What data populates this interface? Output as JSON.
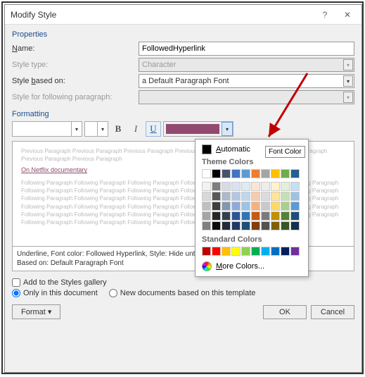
{
  "window": {
    "title": "Modify Style"
  },
  "properties": {
    "header": "Properties",
    "name_label": "Name:",
    "name_value": "FollowedHyperlink",
    "styletype_label": "Style type:",
    "styletype_value": "Character",
    "based_label": "Style based on:",
    "based_value": "a Default Paragraph Font",
    "follow_label": "Style for following paragraph:"
  },
  "formatting": {
    "header": "Formatting",
    "bold": "B",
    "italic": "I",
    "underline": "U"
  },
  "preview": {
    "filler1": "Previous Paragraph Previous Paragraph Previous Paragraph Previous Paragraph Previous Paragraph Previous Paragraph Previous Paragraph Previous Paragraph",
    "link": "On Netflix documentary ",
    "filler2": "Following Paragraph Following Paragraph Following Paragraph Following Paragraph Following Paragraph Following Paragraph Following Paragraph Following Paragraph Following Paragraph Following Paragraph Following Paragraph Following Paragraph Following Paragraph Following Paragraph Following Paragraph Following Paragraph Following Paragraph Following Paragraph Following Paragraph Following Paragraph Following Paragraph Following Paragraph Following Paragraph Following Paragraph Following Paragraph Following Paragraph Following Paragraph Following Paragraph Following Paragraph Following Paragraph Following Paragraph Following Paragraph Following Paragraph Following Paragraph Following Paragraph"
  },
  "description": {
    "line1": "Underline, Font color: Followed Hyperlink, Style: Hide until used, Priority: 100",
    "line2": "Based on: Default Paragraph Font"
  },
  "options": {
    "add_gallery": "Add to the Styles gallery",
    "only_doc": "Only in this document",
    "new_docs": "New documents based on this template"
  },
  "buttons": {
    "format": "Format ▾",
    "ok": "OK",
    "cancel": "Cancel"
  },
  "color_popup": {
    "automatic": "Automatic",
    "theme_hdr": "Theme Colors",
    "std_hdr": "Standard Colors",
    "more": "More Colors...",
    "theme_top": [
      "#ffffff",
      "#000000",
      "#44546a",
      "#4472c4",
      "#5b9bd5",
      "#ed7d31",
      "#a5a5a5",
      "#ffc000",
      "#70ad47",
      "#255e91"
    ],
    "theme_grid": [
      [
        "#f2f2f2",
        "#7f7f7f",
        "#d6dce4",
        "#d9e2f3",
        "#deebf6",
        "#fbe5d5",
        "#ededed",
        "#fff2cc",
        "#e2efd9",
        "#c5e0f3"
      ],
      [
        "#d8d8d8",
        "#595959",
        "#adb9ca",
        "#b4c6e7",
        "#bdd7ee",
        "#f7cbac",
        "#dbdbdb",
        "#fee599",
        "#c5e0b3",
        "#9cc2e5"
      ],
      [
        "#bfbfbf",
        "#3f3f3f",
        "#8496b0",
        "#8eaadb",
        "#9cc3e5",
        "#f4b183",
        "#c9c9c9",
        "#ffd965",
        "#a8d08d",
        "#5b9bd5"
      ],
      [
        "#a5a5a5",
        "#262626",
        "#323f4f",
        "#2f5496",
        "#2e75b5",
        "#c55a11",
        "#7b7b7b",
        "#bf9000",
        "#538135",
        "#1f4e79"
      ],
      [
        "#7f7f7f",
        "#0c0c0c",
        "#222a35",
        "#1f3864",
        "#1e4e79",
        "#833c0b",
        "#525252",
        "#7f6000",
        "#375623",
        "#132f4c"
      ]
    ],
    "standard": [
      "#c00000",
      "#ff0000",
      "#ffc000",
      "#ffff00",
      "#92d050",
      "#00b050",
      "#00b0f0",
      "#0070c0",
      "#002060",
      "#7030a0"
    ]
  },
  "tooltip": "Font Color"
}
